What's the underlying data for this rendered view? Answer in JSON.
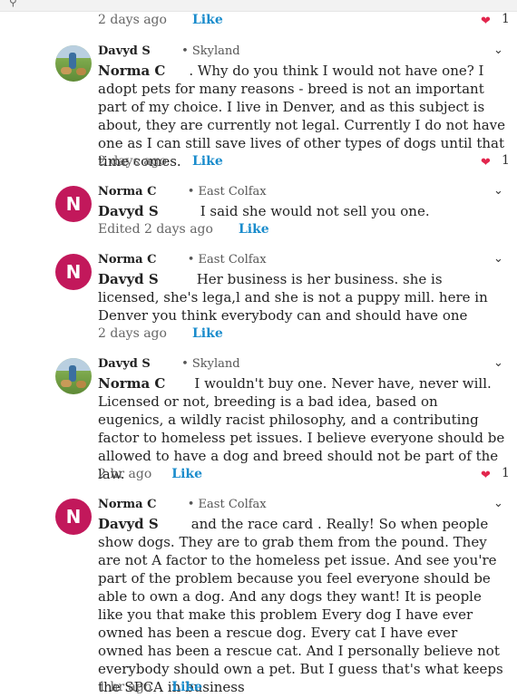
{
  "top": {
    "time": "2 days ago",
    "like": "Like",
    "heart_count": "1"
  },
  "comments": [
    {
      "author": "Davyd S",
      "location": "• Skyland",
      "reply_to": "Norma C",
      "text": ". Why do you think I would not have one?  I adopt pets for many reasons - breed is not an important part of my choice.  I live in Denver, and as this subject is about, they are currently not legal.  Currently I do not have one as I can still save lives of other types of dogs until that time comes.",
      "time": "2 days ago",
      "like": "Like",
      "heart_count": "1"
    },
    {
      "author": "Norma C",
      "location": "• East Colfax",
      "reply_to": "Davyd S",
      "text": "I said she would not sell you one.",
      "time": "Edited 2 days ago",
      "like": "Like"
    },
    {
      "author": "Norma C",
      "location": "• East Colfax",
      "reply_to": "Davyd S",
      "text": "Her business is her business. she is licensed, she's lega,l and she is not a puppy mill.   here in Denver you think everybody can and should have one",
      "time": "2 days ago",
      "like": "Like"
    },
    {
      "author": "Davyd S",
      "location": "• Skyland",
      "reply_to": "Norma C",
      "text": "I wouldn't buy one.   Never have, never will. Licensed or not, breeding is a bad idea, based on eugenics, a wildly racist philosophy, and a contributing factor to homeless pet issues.   I believe everyone should be allowed to have a dog and breed should not be part of the law.",
      "time": "2 hr ago",
      "like": "Like",
      "heart_count": "1"
    },
    {
      "author": "Norma C",
      "location": "• East Colfax",
      "reply_to": "Davyd S",
      "text": "and the race card . Really!  So when people show dogs. They are to grab them from the pound.  They are not A factor to the homeless pet issue. And see you're part of the problem because you feel everyone should be able to own a dog. And any dogs they want!  It is people like you that make this problem  Every dog I have ever owned has been a rescue dog. Every cat I have ever owned has been a rescue cat. And I personally believe not everybody should own a pet. But I guess that's what keeps the SPCA in business",
      "time": "1 hr ago",
      "like": "Like"
    }
  ],
  "avatar_letter": "N",
  "colors": {
    "like": "#1a8ccc",
    "heart": "#e2264d",
    "avatar_bg": "#c2185b"
  },
  "icons": {
    "heart": "heart-icon",
    "chevron": "chevron-down-icon"
  }
}
